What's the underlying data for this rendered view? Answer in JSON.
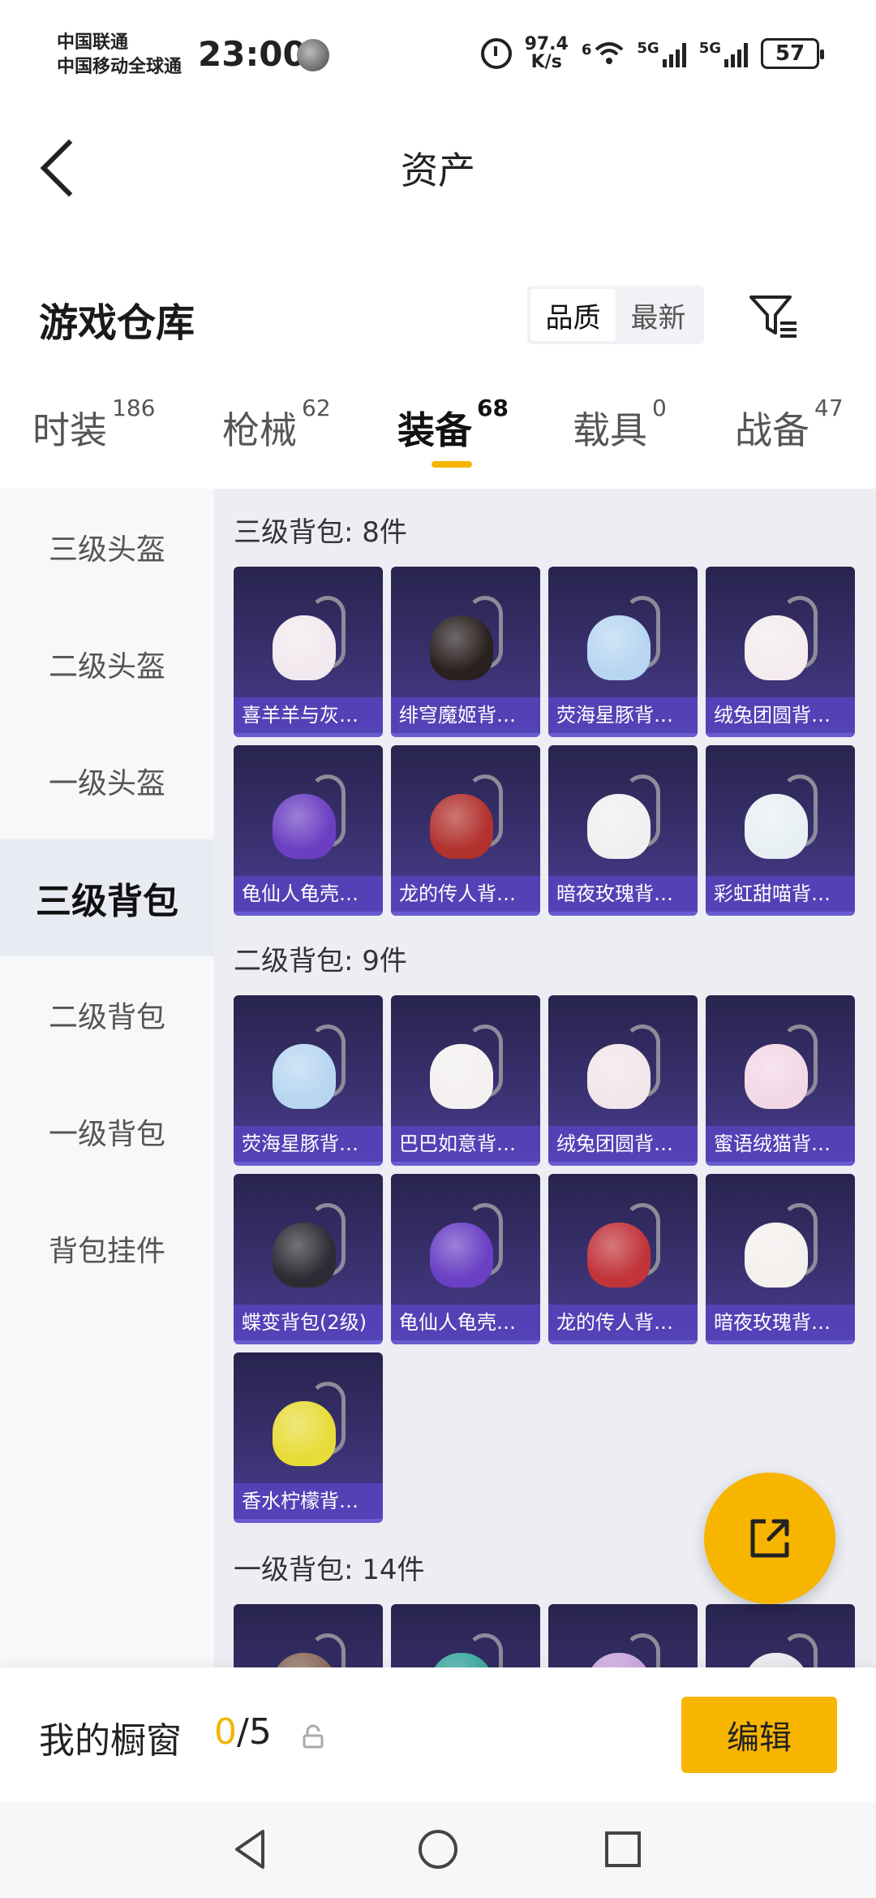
{
  "status_bar": {
    "carrier_1": "中国联通",
    "carrier_2": "中国移动全球通",
    "time": "23:00",
    "net_speed_value": "97.4",
    "net_speed_unit": "K/s",
    "wifi_label": "6",
    "sig1_label": "5G",
    "sig2_label": "5G",
    "battery": "57"
  },
  "header": {
    "title": "资产"
  },
  "warehouse": {
    "title": "游戏仓库",
    "sort_options": [
      "品质",
      "最新"
    ],
    "active_sort": "品质"
  },
  "tabs": [
    {
      "label": "时装",
      "count": "186"
    },
    {
      "label": "枪械",
      "count": "62"
    },
    {
      "label": "装备",
      "count": "68"
    },
    {
      "label": "载具",
      "count": "0"
    },
    {
      "label": "战备",
      "count": "47"
    }
  ],
  "active_tab": "装备",
  "sidebar": [
    {
      "label": "三级头盔"
    },
    {
      "label": "二级头盔"
    },
    {
      "label": "一级头盔"
    },
    {
      "label": "三级背包"
    },
    {
      "label": "二级背包"
    },
    {
      "label": "一级背包"
    },
    {
      "label": "背包挂件"
    }
  ],
  "active_sidebar": "三级背包",
  "groups": [
    {
      "title": "三级背包: 8件",
      "items": [
        {
          "label": "喜羊羊与灰太...",
          "color": "#f2e9ee"
        },
        {
          "label": "绯穹魔姬背包...",
          "color": "#2a2020"
        },
        {
          "label": "荧海星豚背包...",
          "color": "#b8d6f2"
        },
        {
          "label": "绒兔团圆背包...",
          "color": "#f4ecee"
        },
        {
          "label": "龟仙人龟壳背...",
          "color": "#6b3fc2"
        },
        {
          "label": "龙的传人背包...",
          "color": "#b2322e"
        },
        {
          "label": "暗夜玫瑰背包...",
          "color": "#f0f0f0"
        },
        {
          "label": "彩虹甜喵背包...",
          "color": "#e8f0f4"
        }
      ]
    },
    {
      "title": "二级背包: 9件",
      "items": [
        {
          "label": "荧海星豚背包...",
          "color": "#b8d6f2"
        },
        {
          "label": "巴巴如意背包...",
          "color": "#f4f0f0"
        },
        {
          "label": "绒兔团圆背包...",
          "color": "#f2e6ea"
        },
        {
          "label": "蜜语绒猫背包...",
          "color": "#f2d8e6"
        },
        {
          "label": "蝶变背包(2级)",
          "color": "#2c2c34"
        },
        {
          "label": "龟仙人龟壳背...",
          "color": "#6a40c4"
        },
        {
          "label": "龙的传人背包...",
          "color": "#c1343a"
        },
        {
          "label": "暗夜玫瑰背包...",
          "color": "#f4f0ee"
        },
        {
          "label": "香水柠檬背包...",
          "color": "#e8dc3a"
        }
      ]
    },
    {
      "title": "一级背包: 14件",
      "items": [
        {
          "label": "",
          "color": "#8a6a5a"
        },
        {
          "label": "",
          "color": "#3aa8a0"
        },
        {
          "label": "",
          "color": "#c9a4e0"
        },
        {
          "label": "",
          "color": "#e8e8ee"
        }
      ]
    }
  ],
  "bottom_bar": {
    "title": "我的橱窗",
    "count_highlight": "0",
    "count_rest": "/5",
    "edit_label": "编辑"
  },
  "colors": {
    "accent": "#f7b500",
    "card_bg": "#3b3272",
    "card_label_bg": "#5644be"
  }
}
